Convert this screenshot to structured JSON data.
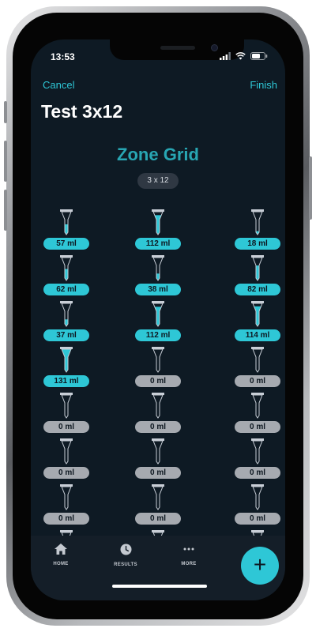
{
  "status": {
    "time": "13:53"
  },
  "nav": {
    "cancel": "Cancel",
    "finish": "Finish"
  },
  "page": {
    "title": "Test 3x12"
  },
  "zone": {
    "title": "Zone Grid",
    "dims": "3 x 12"
  },
  "grid": {
    "columns": 3,
    "cells": [
      {
        "row": 0,
        "col": 0,
        "label": "57 ml",
        "fill": 0.45
      },
      {
        "row": 0,
        "col": 1,
        "label": "112 ml",
        "fill": 0.85
      },
      {
        "row": 0,
        "col": 2,
        "label": "18 ml",
        "fill": 0.15
      },
      {
        "row": 1,
        "col": 0,
        "label": "62 ml",
        "fill": 0.5
      },
      {
        "row": 1,
        "col": 1,
        "label": "38 ml",
        "fill": 0.3
      },
      {
        "row": 1,
        "col": 2,
        "label": "82 ml",
        "fill": 0.65
      },
      {
        "row": 2,
        "col": 0,
        "label": "37 ml",
        "fill": 0.3
      },
      {
        "row": 2,
        "col": 1,
        "label": "112 ml",
        "fill": 0.85
      },
      {
        "row": 2,
        "col": 2,
        "label": "114 ml",
        "fill": 0.87
      },
      {
        "row": 3,
        "col": 0,
        "label": "131 ml",
        "fill": 1.0
      },
      {
        "row": 3,
        "col": 1,
        "label": "0 ml",
        "fill": 0
      },
      {
        "row": 3,
        "col": 2,
        "label": "0 ml",
        "fill": 0
      },
      {
        "row": 4,
        "col": 0,
        "label": "0 ml",
        "fill": 0
      },
      {
        "row": 4,
        "col": 1,
        "label": "0 ml",
        "fill": 0
      },
      {
        "row": 4,
        "col": 2,
        "label": "0 ml",
        "fill": 0
      },
      {
        "row": 5,
        "col": 0,
        "label": "0 ml",
        "fill": 0
      },
      {
        "row": 5,
        "col": 1,
        "label": "0 ml",
        "fill": 0
      },
      {
        "row": 5,
        "col": 2,
        "label": "0 ml",
        "fill": 0
      },
      {
        "row": 6,
        "col": 0,
        "label": "0 ml",
        "fill": 0
      },
      {
        "row": 6,
        "col": 1,
        "label": "0 ml",
        "fill": 0
      },
      {
        "row": 6,
        "col": 2,
        "label": "0 ml",
        "fill": 0
      },
      {
        "row": 7,
        "col": 0,
        "label": "",
        "fill": 0
      },
      {
        "row": 7,
        "col": 1,
        "label": "",
        "fill": 0
      },
      {
        "row": 7,
        "col": 2,
        "label": "",
        "fill": 0
      }
    ]
  },
  "tabs": [
    {
      "label": "HOME",
      "icon": "home-icon"
    },
    {
      "label": "RESULTS",
      "icon": "clock-icon"
    },
    {
      "label": "MORE",
      "icon": "more-icon"
    }
  ],
  "fab": {
    "symbol": "+",
    "icon": "plus-icon"
  },
  "colors": {
    "accent": "#2ec7d6",
    "background": "#0e1a24",
    "title_accent": "#28a6b3",
    "empty_pill": "#a6aab0"
  }
}
